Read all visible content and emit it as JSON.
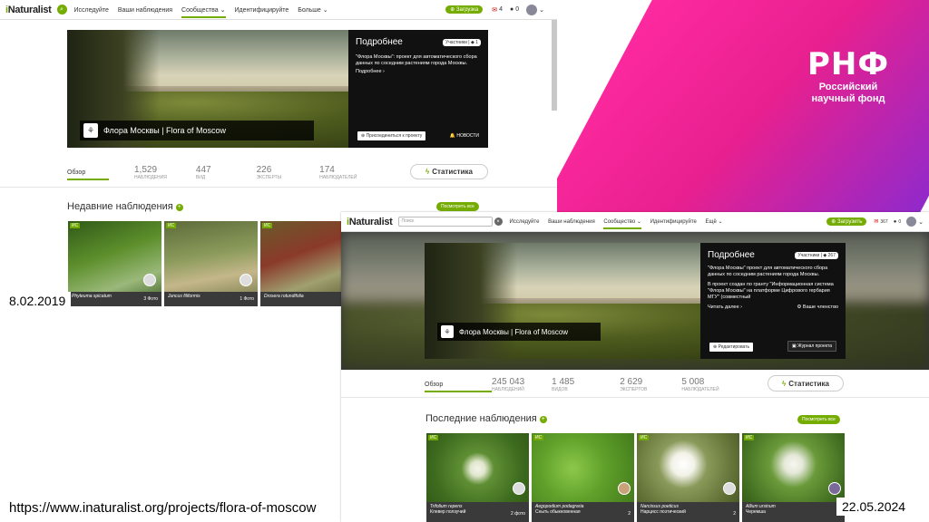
{
  "brand": {
    "logo_text": "РНФ",
    "name_line1": "Российский",
    "name_line2": "научный фонд",
    "accent": "#e8208f"
  },
  "old": {
    "logo_i": "i",
    "logo_rest": "Naturalist",
    "nav": [
      "Исследуйте",
      "Ваши наблюдения",
      "Сообщества ⌄",
      "Идентифицируйте",
      "Больше ⌄"
    ],
    "upload": "⊕ Загрузка",
    "msg_count": "4",
    "chat_count": "0",
    "project_title": "Флора Москвы | Flora of Moscow",
    "info": {
      "heading": "Подробнее",
      "members_label": "Участники",
      "members_count": "1",
      "desc": "\"Флора Москвы\": проект для автоматического сбора данных по соседним растениям города Москвы.",
      "more": "Подробнее ›",
      "join": "⊕ Присоединиться к проекту",
      "news": "НОВОСТИ"
    },
    "stats": [
      {
        "n": "1,529",
        "l": "НАБЛЮДЕНИЯ"
      },
      {
        "n": "447",
        "l": "ВИД"
      },
      {
        "n": "226",
        "l": "ЭКСПЕРТЫ"
      },
      {
        "n": "174",
        "l": "НАБЛЮДАТЕЛЕЙ"
      }
    ],
    "tab": "Обзор",
    "stats_btn": "Статистика",
    "recent": "Недавние наблюдения",
    "see_all": "Посмотреть все",
    "tiles": [
      {
        "name": "Phyteuma spicatum",
        "meta": "3 Фото"
      },
      {
        "name": "Juncus filiformis",
        "meta": "1 Фото"
      },
      {
        "name": "Drosera rotundifolia",
        "meta": ""
      }
    ]
  },
  "new": {
    "logo_i": "i",
    "logo_rest": "Naturalist",
    "search_placeholder": "Поиск",
    "nav": [
      "Исследуйте",
      "Ваши наблюдения",
      "Сообщество ⌄",
      "Идентифицируйте",
      "Ещё ⌄"
    ],
    "upload": "⊕ Загрузить",
    "msg_count": "367",
    "chat_count": "0",
    "project_title": "Флора Москвы | Flora of Moscow",
    "info": {
      "heading": "Подробнее",
      "members_label": "Участники",
      "members_count": "267",
      "desc": "\"Флора Москвы\" проект для автоматического сбора данных по соседним растениям города Москвы.",
      "desc2": "В проект создан по гранту \"Информационная система \"Флора Москвы\" на платформе Цифрового гербария МГУ\" (совместный",
      "more": "Читать далее ›",
      "membership": "⚙ Ваше членство",
      "edit": "⊕ Редактировать",
      "journal": "▣ Журнал проекта"
    },
    "stats": [
      {
        "n": "245 043",
        "l": "НАБЛЮДЕНИЙ"
      },
      {
        "n": "1 485",
        "l": "ВИДОВ"
      },
      {
        "n": "2 629",
        "l": "ЭКСПЕРТОВ"
      },
      {
        "n": "5 008",
        "l": "НАБЛЮДАТЕЛЕЙ"
      }
    ],
    "tab": "Обзор",
    "stats_btn": "Статистика",
    "recent": "Последние наблюдения",
    "see_all": "Посмотреть все",
    "tiles": [
      {
        "name": "Trifolium repens",
        "common": "Клевер ползучий",
        "meta": "2 фото"
      },
      {
        "name": "Aegopodium podagraria",
        "common": "Сныть обыкновенная",
        "meta": "2"
      },
      {
        "name": "Narcissus poeticus",
        "common": "Нарцисс поэтический",
        "meta": "2"
      },
      {
        "name": "Allium ursinum",
        "common": "Черемша",
        "meta": "2"
      }
    ]
  },
  "date_old": "8.02.2019",
  "date_new": "22.05.2024",
  "url": "https://www.inaturalist.org/projects/flora-of-moscow"
}
